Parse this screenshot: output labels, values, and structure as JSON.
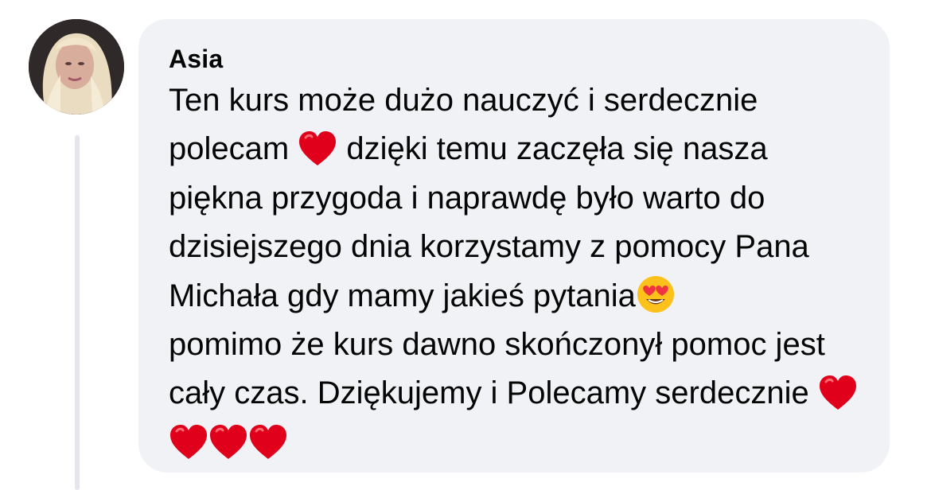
{
  "comment": {
    "avatar_icon": "profile-photo",
    "author": "Asia",
    "text_parts": {
      "p1": "Ten kurs może dużo nauczyć i serdecznie polecam ",
      "p2": " dzięki temu zaczęła się nasza piękna przygoda i naprawdę było warto do dzisiejszego dnia korzystamy z pomocy Pana Michała gdy mamy jakieś pytania",
      "p3": " pomimo że kurs dawno skończonył pomoc jest cały czas. Dziękujemy i Polecamy serdecznie "
    },
    "emojis": {
      "heart_name": "red-heart-emoji",
      "heart_eyes_name": "heart-eyes-emoji",
      "trailing_hearts": 4
    },
    "colors": {
      "bubble_bg": "#f0f2f5",
      "text": "#050505",
      "heart": "#e0001b",
      "emoji_face": "#fcc21b"
    }
  }
}
